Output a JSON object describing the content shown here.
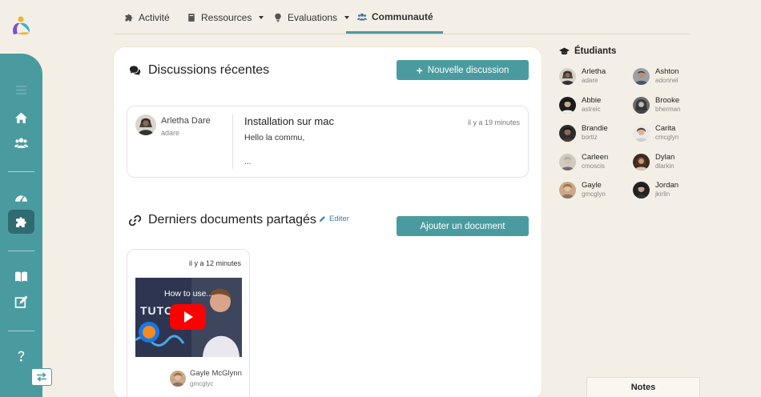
{
  "app": {
    "logo": "app-logo"
  },
  "sidebar": {
    "items": [
      {
        "name": "menu-icon"
      },
      {
        "name": "home-icon"
      },
      {
        "name": "users-icon"
      },
      {
        "name": "dashboard-icon"
      },
      {
        "name": "puzzle-icon",
        "active": true
      },
      {
        "name": "book-icon"
      },
      {
        "name": "edit-icon"
      },
      {
        "name": "help-icon"
      }
    ],
    "toggle": "swap-icon"
  },
  "nav": {
    "tabs": [
      {
        "label": "Activité",
        "icon": "puzzle-icon"
      },
      {
        "label": "Ressources",
        "icon": "book-icon",
        "dropdown": true
      },
      {
        "label": "Evaluations",
        "icon": "bulb-icon",
        "dropdown": true
      },
      {
        "label": "Communauté",
        "icon": "users-icon",
        "active": true
      }
    ]
  },
  "discussions": {
    "title": "Discussions récentes",
    "new_button": "Nouvelle discussion",
    "items": [
      {
        "author": "Arletha Dare",
        "username": "adare",
        "subject": "Installation sur mac",
        "time": "il y a 19 minutes",
        "body": "Hello la commu,",
        "ellipsis": "..."
      }
    ]
  },
  "documents": {
    "title": "Derniers documents partagés",
    "edit_label": "Editer",
    "add_button": "Ajouter un document",
    "items": [
      {
        "time": "il y a 12 minutes",
        "video_title": "How to use...",
        "video_overlay": "TUTO",
        "author": "Gayle McGlynn",
        "username": "gmcglyc"
      }
    ]
  },
  "students": {
    "title": "Étudiants",
    "list": [
      {
        "name": "Arletha",
        "username": "adare"
      },
      {
        "name": "Ashton",
        "username": "adonnel"
      },
      {
        "name": "Abbie",
        "username": "astreic"
      },
      {
        "name": "Brooke",
        "username": "bherman"
      },
      {
        "name": "Brandie",
        "username": "bortiz"
      },
      {
        "name": "Carita",
        "username": "cmcglyn"
      },
      {
        "name": "Carleen",
        "username": "cmoscis"
      },
      {
        "name": "Dylan",
        "username": "dlarkin"
      },
      {
        "name": "Gayle",
        "username": "gmcglyn"
      },
      {
        "name": "Jordan",
        "username": "jkirlin"
      }
    ]
  },
  "notes": {
    "label": "Notes"
  },
  "colors": {
    "accent": "#4a9ba0",
    "accent_dark": "#2f6b70",
    "background": "#f4efe6"
  }
}
